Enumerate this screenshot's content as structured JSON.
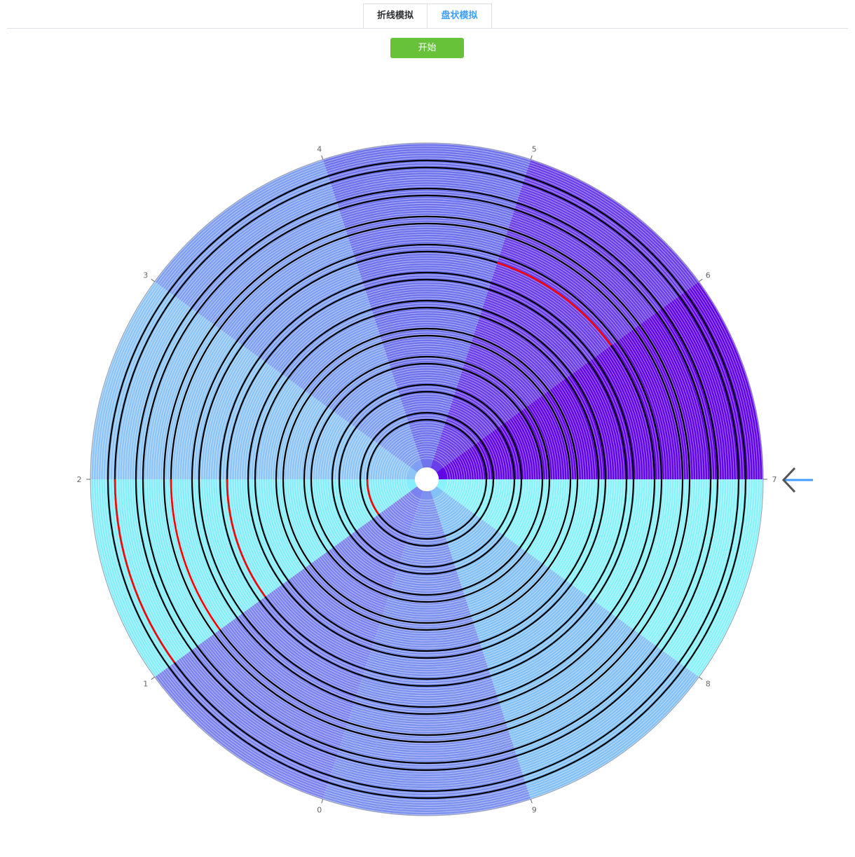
{
  "tabs": [
    {
      "label": "折线模拟",
      "active": false
    },
    {
      "label": "盘状模拟",
      "active": true
    }
  ],
  "start_button": {
    "label": "开始"
  },
  "arrow_icon": "arrow-left-icon",
  "colors": {
    "tab_active": "#409eff",
    "button": "#67c23a",
    "ring_normal": "#000000",
    "ring_highlight": "#ff0000",
    "sector_fills": [
      "#7b83f0",
      "#86edfa",
      "#8ec5f7",
      "#7f9ff3",
      "#6f74ec",
      "#6a3ee8",
      "#6205e6",
      "#89f2fa",
      "#84c1f7",
      "#7d91ef"
    ]
  },
  "chart_data": {
    "type": "polar-sectors",
    "sector_labels": [
      "0",
      "1",
      "2",
      "3",
      "4",
      "5",
      "6",
      "7",
      "8",
      "9"
    ],
    "rings": [
      {
        "index": 1,
        "sectors": [
          1
        ]
      },
      {
        "index": 2,
        "sectors": []
      },
      {
        "index": 3,
        "sectors": []
      },
      {
        "index": 4,
        "sectors": []
      },
      {
        "index": 5,
        "sectors": []
      },
      {
        "index": 6,
        "sectors": [
          1
        ]
      },
      {
        "index": 7,
        "sectors": [
          5
        ]
      },
      {
        "index": 8,
        "sectors": [
          1
        ]
      },
      {
        "index": 9,
        "sectors": []
      },
      {
        "index": 10,
        "sectors": [
          1
        ]
      }
    ]
  }
}
